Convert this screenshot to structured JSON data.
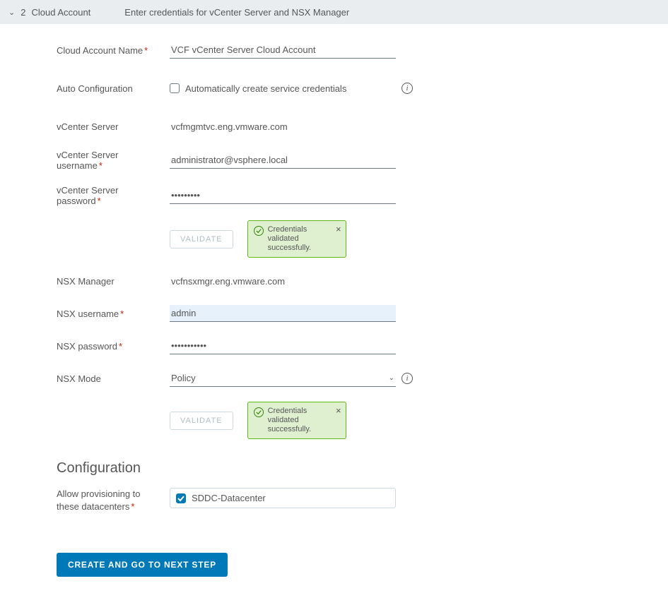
{
  "step": {
    "number": "2",
    "title": "Cloud Account",
    "subtitle": "Enter credentials for vCenter Server and NSX Manager"
  },
  "labels": {
    "accountName": "Cloud Account Name",
    "autoConfig": "Auto Configuration",
    "autoConfigCheckbox": "Automatically create service credentials",
    "vcServer": "vCenter Server",
    "vcUser": "vCenter Server username",
    "vcPass": "vCenter Server password",
    "nsxManager": "NSX Manager",
    "nsxUser": "NSX username",
    "nsxPass": "NSX password",
    "nsxMode": "NSX Mode",
    "validate": "Validate",
    "configSection": "Configuration",
    "allowProv": "Allow provisioning to these datacenters",
    "createNext": "Create and go to next step"
  },
  "values": {
    "accountName": "VCF vCenter Server Cloud Account",
    "vcServer": "vcfmgmtvc.eng.vmware.com",
    "vcUser": "administrator@vsphere.local",
    "vcPass": "•••••••••",
    "nsxManager": "vcfnsxmgr.eng.vmware.com",
    "nsxUser": "admin",
    "nsxPass": "•••••••••••",
    "nsxMode": "Policy",
    "datacenter": "SDDC-Datacenter"
  },
  "toast": {
    "message": "Credentials validated successfully."
  }
}
